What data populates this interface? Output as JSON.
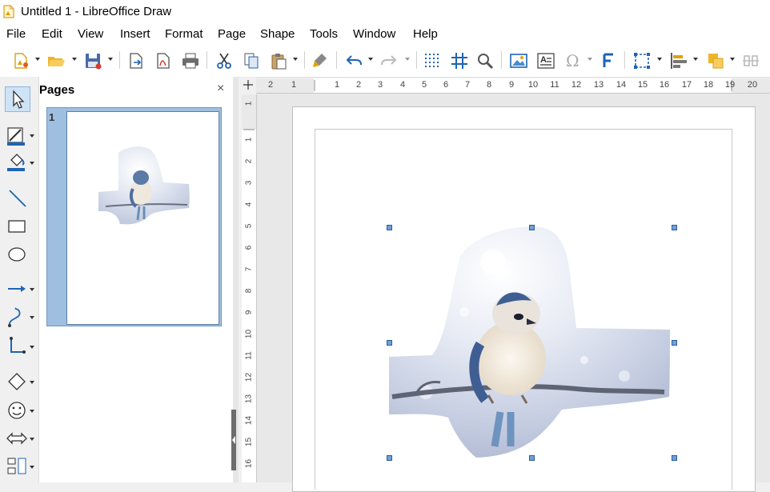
{
  "window": {
    "title": "Untitled 1 - LibreOffice Draw"
  },
  "menu": [
    "File",
    "Edit",
    "View",
    "Insert",
    "Format",
    "Page",
    "Shape",
    "Tools",
    "Window",
    "Help"
  ],
  "pages_panel": {
    "title": "Pages",
    "close": "×",
    "page_number": "1"
  },
  "rulers": {
    "horizontal_ticks": [
      "2",
      "1",
      "1",
      "2",
      "3",
      "4",
      "5",
      "6",
      "7",
      "8",
      "9",
      "10",
      "11",
      "12",
      "13",
      "14",
      "15",
      "16",
      "17",
      "18",
      "19",
      "20"
    ],
    "vertical_ticks": [
      "1",
      "1",
      "2",
      "3",
      "4",
      "5",
      "6",
      "7",
      "8",
      "9",
      "10",
      "11",
      "12",
      "13",
      "14",
      "15",
      "16"
    ]
  },
  "icons": {
    "toolbar": [
      "new-icon",
      "open-icon",
      "save-icon",
      "export-icon",
      "export-pdf-icon",
      "print-icon",
      "cut-icon",
      "copy-icon",
      "paste-icon",
      "clone-formatting-icon",
      "undo-icon",
      "redo-icon",
      "grid-icon",
      "helplines-icon",
      "zoom-icon",
      "insert-image-icon",
      "insert-textbox-icon",
      "special-character-icon",
      "fontwork-icon",
      "transformations-icon",
      "align-icon",
      "arrange-icon",
      "distribute-icon"
    ],
    "left": [
      "select-icon",
      "line-color-icon",
      "fill-color-icon",
      "line-icon",
      "rectangle-icon",
      "ellipse-icon",
      "arrow-icon",
      "curve-icon",
      "connector-icon",
      "basic-shapes-icon",
      "symbol-shapes-icon",
      "block-arrows-icon",
      "flowchart-icon"
    ]
  },
  "colors": {
    "accent": "#1e64b4",
    "selection": "#9ebfe0",
    "handle": "#6f9fd8"
  }
}
